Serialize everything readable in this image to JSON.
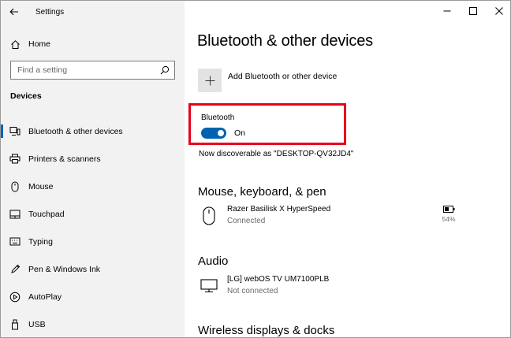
{
  "window": {
    "app_title": "Settings"
  },
  "sidebar": {
    "home_label": "Home",
    "search_placeholder": "Find a setting",
    "section_title": "Devices",
    "items": [
      {
        "label": "Bluetooth & other devices",
        "icon": "bluetooth-devices-icon",
        "active": true
      },
      {
        "label": "Printers & scanners",
        "icon": "printer-icon",
        "active": false
      },
      {
        "label": "Mouse",
        "icon": "mouse-icon",
        "active": false
      },
      {
        "label": "Touchpad",
        "icon": "touchpad-icon",
        "active": false
      },
      {
        "label": "Typing",
        "icon": "keyboard-icon",
        "active": false
      },
      {
        "label": "Pen & Windows Ink",
        "icon": "pen-icon",
        "active": false
      },
      {
        "label": "AutoPlay",
        "icon": "autoplay-icon",
        "active": false
      },
      {
        "label": "USB",
        "icon": "usb-icon",
        "active": false
      }
    ]
  },
  "main": {
    "page_title": "Bluetooth & other devices",
    "add_device_label": "Add Bluetooth or other device",
    "bluetooth": {
      "label": "Bluetooth",
      "state": "On"
    },
    "discoverable_text": "Now discoverable as \"DESKTOP-QV32JD4\"",
    "mouse_section": {
      "title": "Mouse, keyboard, & pen",
      "device_name": "Razer Basilisk X HyperSpeed",
      "device_status": "Connected",
      "battery_percent": "54%"
    },
    "audio_section": {
      "title": "Audio",
      "device_name": "[LG] webOS TV UM7100PLB",
      "device_status": "Not connected"
    },
    "wireless_section": {
      "title": "Wireless displays & docks"
    }
  },
  "colors": {
    "accent": "#0063b1",
    "highlight_box": "#e8001b",
    "sidebar_bg": "#f2f2f2"
  }
}
